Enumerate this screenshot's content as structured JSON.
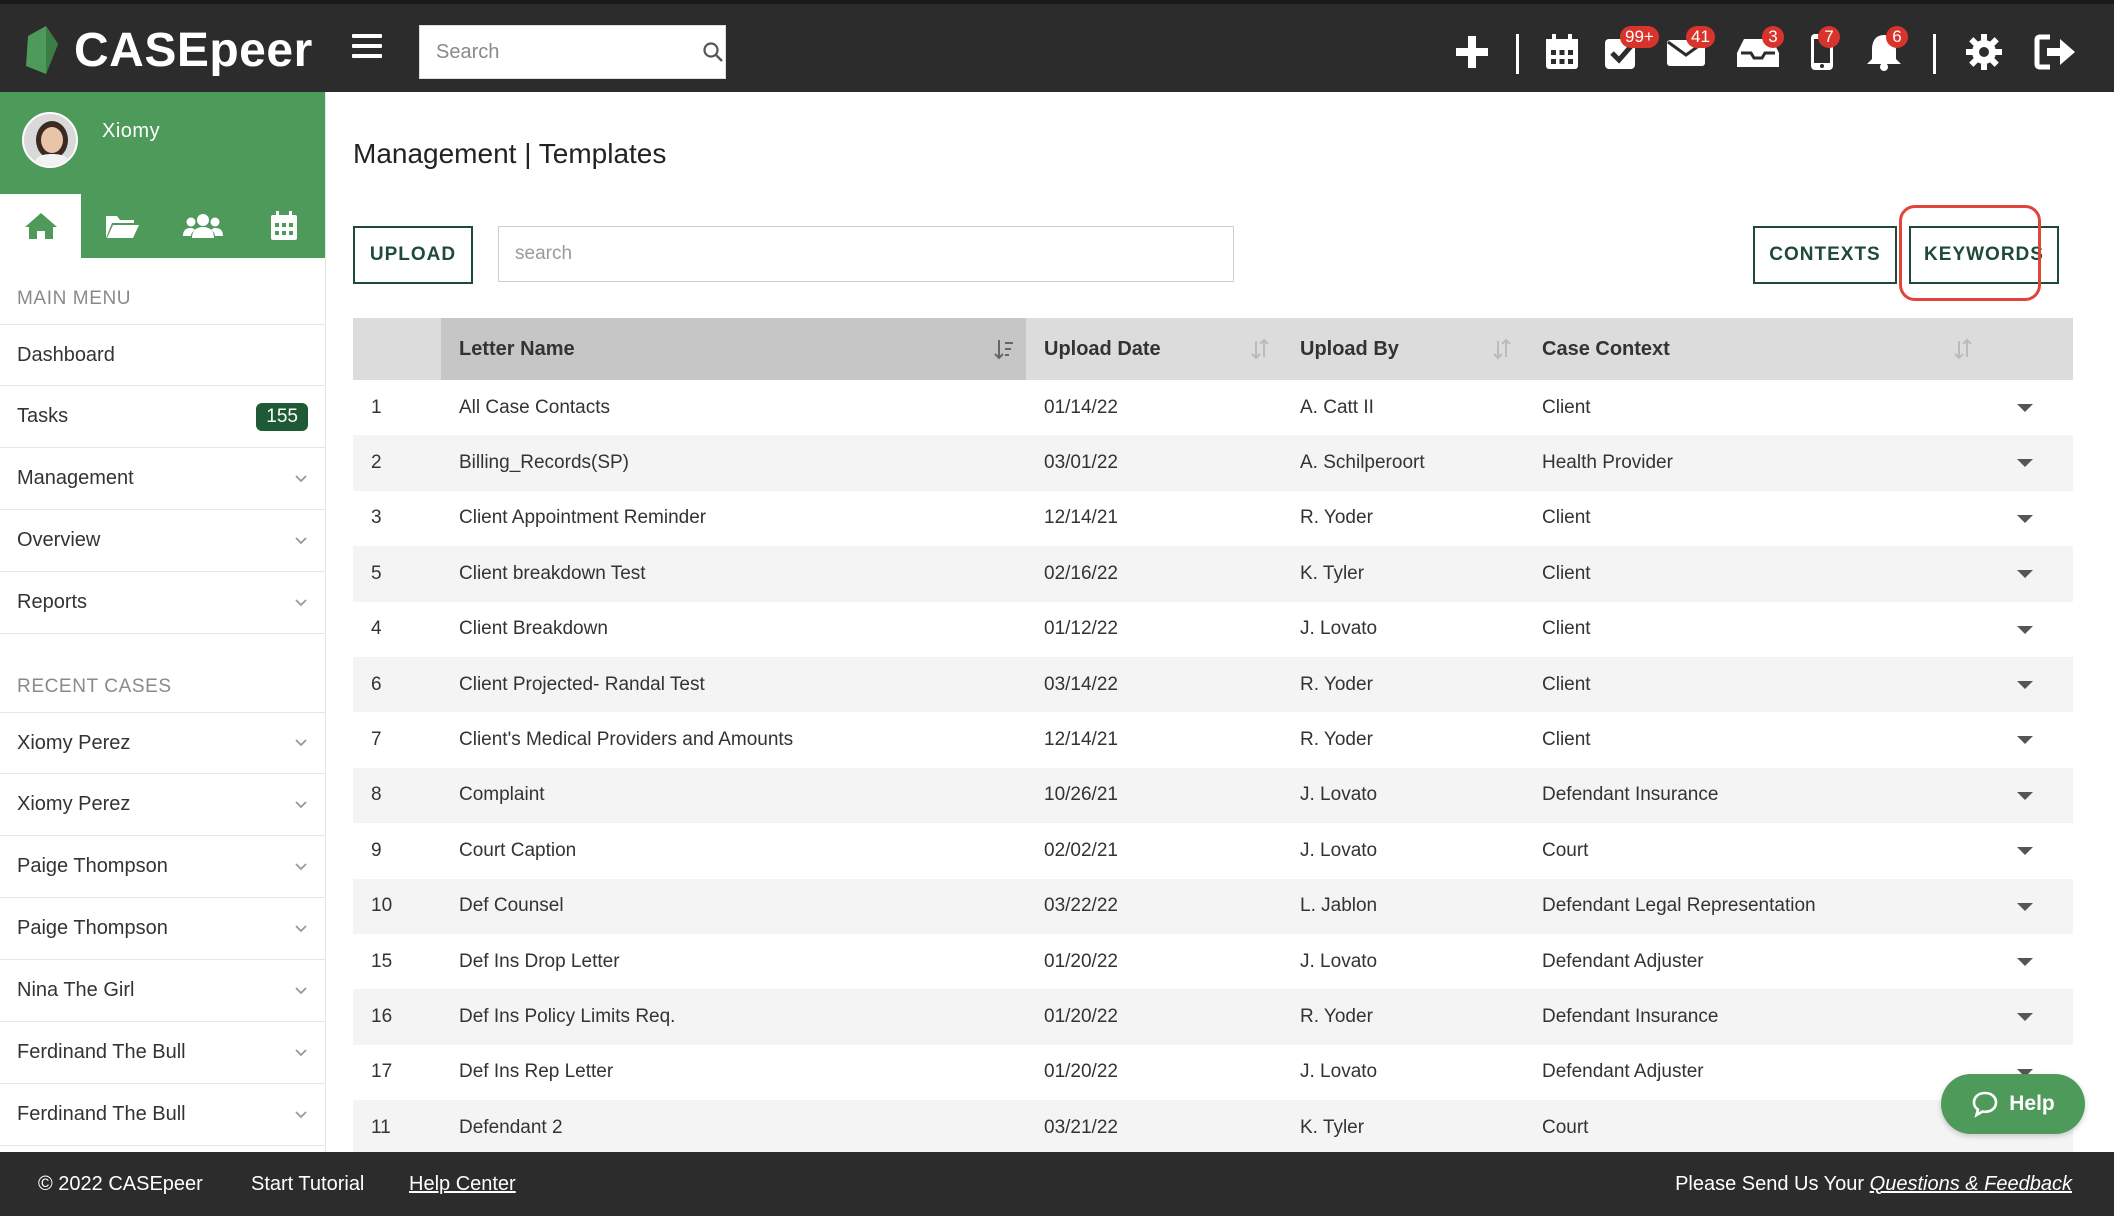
{
  "app": {
    "brand": "CASEpeer",
    "search_placeholder": "Search",
    "colors": {
      "dark": "#2c2c2c",
      "green": "#4d9a5b",
      "dark_green": "#1e4a36",
      "badge_red": "#d9342b"
    }
  },
  "topbar": {
    "badges": {
      "tasks": "99+",
      "mail": "41",
      "inbox": "3",
      "phone": "7",
      "notifications": "6"
    },
    "icons": [
      "plus-icon",
      "calendar-icon",
      "tasks-check-icon",
      "mail-icon",
      "inbox-icon",
      "phone-icon",
      "bell-icon",
      "gear-icon",
      "logout-icon"
    ]
  },
  "sidebar": {
    "user_name": "Xiomy",
    "main_menu_title": "MAIN MENU",
    "menu": [
      {
        "label": "Dashboard"
      },
      {
        "label": "Tasks",
        "count": "155"
      },
      {
        "label": "Management"
      },
      {
        "label": "Overview"
      },
      {
        "label": "Reports"
      }
    ],
    "recent_title": "RECENT CASES",
    "recent": [
      {
        "label": "Xiomy Perez"
      },
      {
        "label": "Xiomy Perez"
      },
      {
        "label": "Paige Thompson"
      },
      {
        "label": "Paige Thompson"
      },
      {
        "label": "Nina The Girl"
      },
      {
        "label": "Ferdinand The Bull"
      },
      {
        "label": "Ferdinand The Bull"
      }
    ]
  },
  "main": {
    "title": "Management | Templates",
    "upload_label": "UPLOAD",
    "search_placeholder": "search",
    "contexts_label": "CONTEXTS",
    "keywords_label": "KEYWORDS",
    "columns": [
      "",
      "Letter Name",
      "Upload Date",
      "Upload By",
      "Case Context"
    ],
    "rows": [
      [
        "1",
        "All Case Contacts",
        "01/14/22",
        "A. Catt II",
        "Client"
      ],
      [
        "2",
        "Billing_Records(SP)",
        "03/01/22",
        "A. Schilperoort",
        "Health Provider"
      ],
      [
        "3",
        "Client Appointment Reminder",
        "12/14/21",
        "R. Yoder",
        "Client"
      ],
      [
        "5",
        "Client breakdown Test",
        "02/16/22",
        "K. Tyler",
        "Client"
      ],
      [
        "4",
        "Client Breakdown",
        "01/12/22",
        "J. Lovato",
        "Client"
      ],
      [
        "6",
        "Client Projected- Randal Test",
        "03/14/22",
        "R. Yoder",
        "Client"
      ],
      [
        "7",
        "Client's Medical Providers and Amounts",
        "12/14/21",
        "R. Yoder",
        "Client"
      ],
      [
        "8",
        "Complaint",
        "10/26/21",
        "J. Lovato",
        "Defendant Insurance"
      ],
      [
        "9",
        "Court Caption",
        "02/02/21",
        "J. Lovato",
        "Court"
      ],
      [
        "10",
        "Def Counsel",
        "03/22/22",
        "L. Jablon",
        "Defendant Legal Representation"
      ],
      [
        "15",
        "Def Ins Drop Letter",
        "01/20/22",
        "J. Lovato",
        "Defendant Adjuster"
      ],
      [
        "16",
        "Def Ins Policy Limits Req.",
        "01/20/22",
        "R. Yoder",
        "Defendant Insurance"
      ],
      [
        "17",
        "Def Ins Rep Letter",
        "01/20/22",
        "J. Lovato",
        "Defendant Adjuster"
      ],
      [
        "11",
        "Defendant 2",
        "03/21/22",
        "K. Tyler",
        "Court"
      ]
    ],
    "help_label": "Help"
  },
  "footer": {
    "copyright": "© 2022 CASEpeer",
    "start_tutorial": "Start Tutorial",
    "help_center": "Help Center",
    "feedback_prefix": "Please Send Us Your ",
    "feedback_link": "Questions & Feedback"
  }
}
